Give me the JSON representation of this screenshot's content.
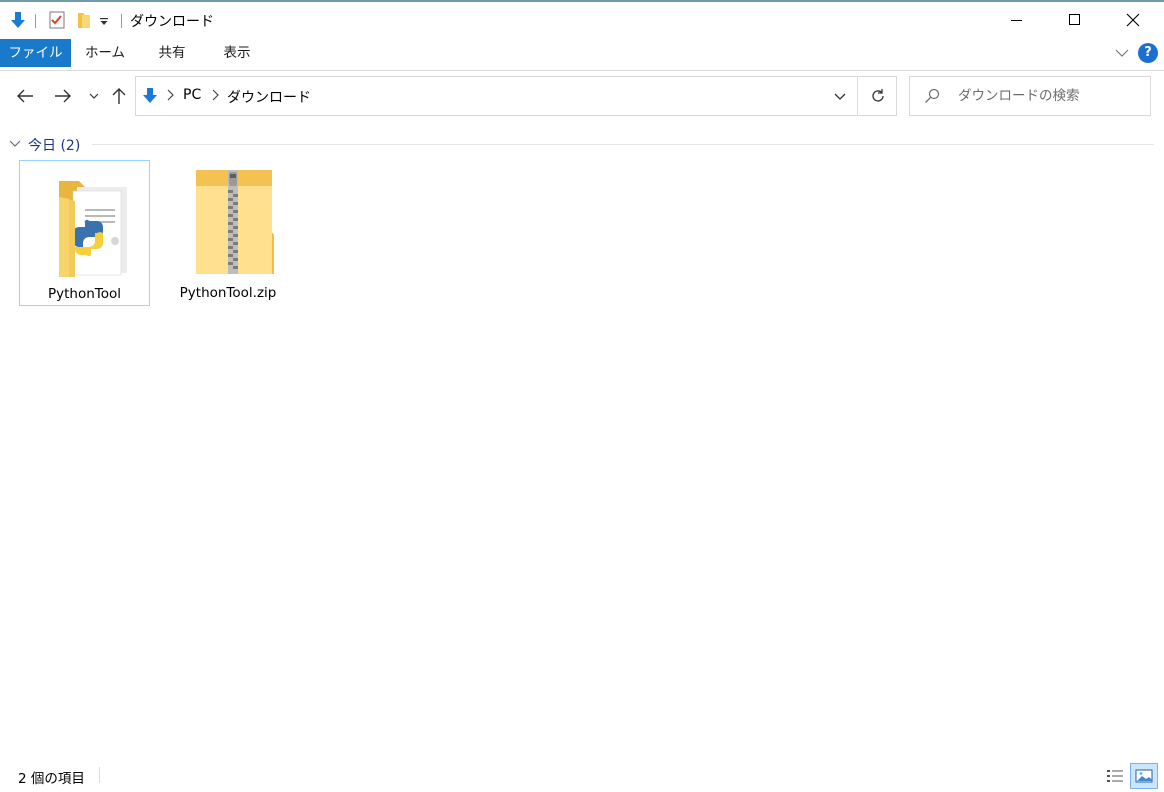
{
  "window": {
    "title": "ダウンロード",
    "quick_access": [
      "download-icon",
      "properties-icon",
      "new-folder-icon",
      "customize-dropdown-icon"
    ]
  },
  "ribbon": {
    "tabs": [
      {
        "label": "ファイル",
        "active": true
      },
      {
        "label": "ホーム",
        "active": false
      },
      {
        "label": "共有",
        "active": false
      },
      {
        "label": "表示",
        "active": false
      }
    ],
    "help_label": "?"
  },
  "navigation": {
    "breadcrumb": [
      "PC",
      "ダウンロード"
    ],
    "search_placeholder": "ダウンロードの検索"
  },
  "group": {
    "label": "今日 (2)"
  },
  "items": [
    {
      "name": "PythonTool",
      "type": "folder",
      "icon": "python-folder-icon",
      "selected": true
    },
    {
      "name": "PythonTool.zip",
      "type": "zip",
      "icon": "zip-folder-icon",
      "selected": false
    }
  ],
  "status": {
    "item_count": "2 個の項目",
    "view_mode": "large-icons"
  },
  "colors": {
    "accent": "#1979ca",
    "group_label": "#1e3287",
    "selection_border": "#99d1ff"
  }
}
